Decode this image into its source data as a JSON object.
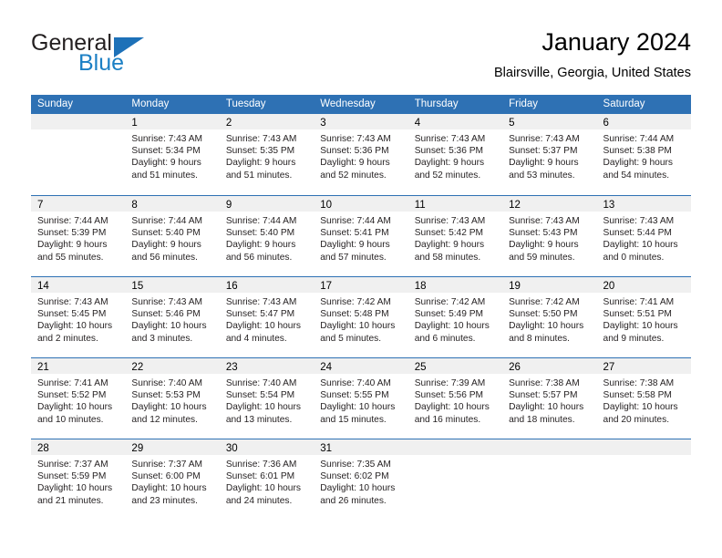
{
  "brand": {
    "name_part1": "General",
    "name_part2": "Blue",
    "triangle_icon": "triangle-icon"
  },
  "header": {
    "title": "January 2024",
    "subtitle": "Blairsville, Georgia, United States"
  },
  "calendar": {
    "weekday_headers": [
      "Sunday",
      "Monday",
      "Tuesday",
      "Wednesday",
      "Thursday",
      "Friday",
      "Saturday"
    ],
    "colors": {
      "header_blue": "#2e71b4",
      "brand_blue": "#1b7fc4",
      "day_band_gray": "#f0f0f0",
      "text": "#231f20"
    },
    "weeks": [
      [
        {
          "day": "",
          "lines": []
        },
        {
          "day": "1",
          "lines": [
            "Sunrise: 7:43 AM",
            "Sunset: 5:34 PM",
            "Daylight: 9 hours",
            "and 51 minutes."
          ]
        },
        {
          "day": "2",
          "lines": [
            "Sunrise: 7:43 AM",
            "Sunset: 5:35 PM",
            "Daylight: 9 hours",
            "and 51 minutes."
          ]
        },
        {
          "day": "3",
          "lines": [
            "Sunrise: 7:43 AM",
            "Sunset: 5:36 PM",
            "Daylight: 9 hours",
            "and 52 minutes."
          ]
        },
        {
          "day": "4",
          "lines": [
            "Sunrise: 7:43 AM",
            "Sunset: 5:36 PM",
            "Daylight: 9 hours",
            "and 52 minutes."
          ]
        },
        {
          "day": "5",
          "lines": [
            "Sunrise: 7:43 AM",
            "Sunset: 5:37 PM",
            "Daylight: 9 hours",
            "and 53 minutes."
          ]
        },
        {
          "day": "6",
          "lines": [
            "Sunrise: 7:44 AM",
            "Sunset: 5:38 PM",
            "Daylight: 9 hours",
            "and 54 minutes."
          ]
        }
      ],
      [
        {
          "day": "7",
          "lines": [
            "Sunrise: 7:44 AM",
            "Sunset: 5:39 PM",
            "Daylight: 9 hours",
            "and 55 minutes."
          ]
        },
        {
          "day": "8",
          "lines": [
            "Sunrise: 7:44 AM",
            "Sunset: 5:40 PM",
            "Daylight: 9 hours",
            "and 56 minutes."
          ]
        },
        {
          "day": "9",
          "lines": [
            "Sunrise: 7:44 AM",
            "Sunset: 5:40 PM",
            "Daylight: 9 hours",
            "and 56 minutes."
          ]
        },
        {
          "day": "10",
          "lines": [
            "Sunrise: 7:44 AM",
            "Sunset: 5:41 PM",
            "Daylight: 9 hours",
            "and 57 minutes."
          ]
        },
        {
          "day": "11",
          "lines": [
            "Sunrise: 7:43 AM",
            "Sunset: 5:42 PM",
            "Daylight: 9 hours",
            "and 58 minutes."
          ]
        },
        {
          "day": "12",
          "lines": [
            "Sunrise: 7:43 AM",
            "Sunset: 5:43 PM",
            "Daylight: 9 hours",
            "and 59 minutes."
          ]
        },
        {
          "day": "13",
          "lines": [
            "Sunrise: 7:43 AM",
            "Sunset: 5:44 PM",
            "Daylight: 10 hours",
            "and 0 minutes."
          ]
        }
      ],
      [
        {
          "day": "14",
          "lines": [
            "Sunrise: 7:43 AM",
            "Sunset: 5:45 PM",
            "Daylight: 10 hours",
            "and 2 minutes."
          ]
        },
        {
          "day": "15",
          "lines": [
            "Sunrise: 7:43 AM",
            "Sunset: 5:46 PM",
            "Daylight: 10 hours",
            "and 3 minutes."
          ]
        },
        {
          "day": "16",
          "lines": [
            "Sunrise: 7:43 AM",
            "Sunset: 5:47 PM",
            "Daylight: 10 hours",
            "and 4 minutes."
          ]
        },
        {
          "day": "17",
          "lines": [
            "Sunrise: 7:42 AM",
            "Sunset: 5:48 PM",
            "Daylight: 10 hours",
            "and 5 minutes."
          ]
        },
        {
          "day": "18",
          "lines": [
            "Sunrise: 7:42 AM",
            "Sunset: 5:49 PM",
            "Daylight: 10 hours",
            "and 6 minutes."
          ]
        },
        {
          "day": "19",
          "lines": [
            "Sunrise: 7:42 AM",
            "Sunset: 5:50 PM",
            "Daylight: 10 hours",
            "and 8 minutes."
          ]
        },
        {
          "day": "20",
          "lines": [
            "Sunrise: 7:41 AM",
            "Sunset: 5:51 PM",
            "Daylight: 10 hours",
            "and 9 minutes."
          ]
        }
      ],
      [
        {
          "day": "21",
          "lines": [
            "Sunrise: 7:41 AM",
            "Sunset: 5:52 PM",
            "Daylight: 10 hours",
            "and 10 minutes."
          ]
        },
        {
          "day": "22",
          "lines": [
            "Sunrise: 7:40 AM",
            "Sunset: 5:53 PM",
            "Daylight: 10 hours",
            "and 12 minutes."
          ]
        },
        {
          "day": "23",
          "lines": [
            "Sunrise: 7:40 AM",
            "Sunset: 5:54 PM",
            "Daylight: 10 hours",
            "and 13 minutes."
          ]
        },
        {
          "day": "24",
          "lines": [
            "Sunrise: 7:40 AM",
            "Sunset: 5:55 PM",
            "Daylight: 10 hours",
            "and 15 minutes."
          ]
        },
        {
          "day": "25",
          "lines": [
            "Sunrise: 7:39 AM",
            "Sunset: 5:56 PM",
            "Daylight: 10 hours",
            "and 16 minutes."
          ]
        },
        {
          "day": "26",
          "lines": [
            "Sunrise: 7:38 AM",
            "Sunset: 5:57 PM",
            "Daylight: 10 hours",
            "and 18 minutes."
          ]
        },
        {
          "day": "27",
          "lines": [
            "Sunrise: 7:38 AM",
            "Sunset: 5:58 PM",
            "Daylight: 10 hours",
            "and 20 minutes."
          ]
        }
      ],
      [
        {
          "day": "28",
          "lines": [
            "Sunrise: 7:37 AM",
            "Sunset: 5:59 PM",
            "Daylight: 10 hours",
            "and 21 minutes."
          ]
        },
        {
          "day": "29",
          "lines": [
            "Sunrise: 7:37 AM",
            "Sunset: 6:00 PM",
            "Daylight: 10 hours",
            "and 23 minutes."
          ]
        },
        {
          "day": "30",
          "lines": [
            "Sunrise: 7:36 AM",
            "Sunset: 6:01 PM",
            "Daylight: 10 hours",
            "and 24 minutes."
          ]
        },
        {
          "day": "31",
          "lines": [
            "Sunrise: 7:35 AM",
            "Sunset: 6:02 PM",
            "Daylight: 10 hours",
            "and 26 minutes."
          ]
        },
        {
          "day": "",
          "lines": []
        },
        {
          "day": "",
          "lines": []
        },
        {
          "day": "",
          "lines": []
        }
      ]
    ]
  }
}
